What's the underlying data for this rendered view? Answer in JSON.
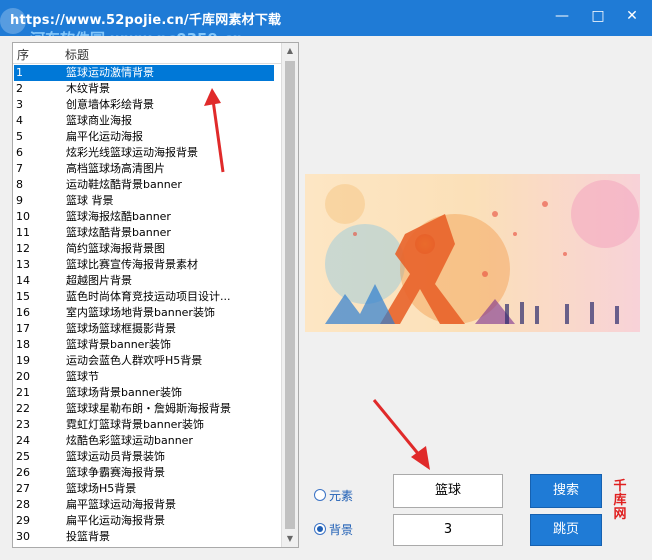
{
  "window": {
    "title": "https://www.52pojie.cn/千库网素材下载",
    "watermark": "河东软件园 www.pc0359.cn"
  },
  "list": {
    "col_index": "序",
    "col_title": "标题",
    "rows": [
      {
        "n": "1",
        "t": "篮球运动激情背景"
      },
      {
        "n": "2",
        "t": "木纹背景"
      },
      {
        "n": "3",
        "t": "创意墙体彩绘背景"
      },
      {
        "n": "4",
        "t": "篮球商业海报"
      },
      {
        "n": "5",
        "t": "扁平化运动海报"
      },
      {
        "n": "6",
        "t": "炫彩光线篮球运动海报背景"
      },
      {
        "n": "7",
        "t": "高档篮球场高清图片"
      },
      {
        "n": "8",
        "t": "运动鞋炫酷背景banner"
      },
      {
        "n": "9",
        "t": "篮球 背景"
      },
      {
        "n": "10",
        "t": "篮球海报炫酷banner"
      },
      {
        "n": "11",
        "t": "篮球炫酷背景banner"
      },
      {
        "n": "12",
        "t": "简约篮球海报背景图"
      },
      {
        "n": "13",
        "t": "篮球比赛宣传海报背景素材"
      },
      {
        "n": "14",
        "t": "超越图片背景"
      },
      {
        "n": "15",
        "t": "蓝色时尚体育竞技运动项目设计..."
      },
      {
        "n": "16",
        "t": "室内篮球场地背景banner装饰"
      },
      {
        "n": "17",
        "t": "篮球场篮球框摄影背景"
      },
      {
        "n": "18",
        "t": "篮球背景banner装饰"
      },
      {
        "n": "19",
        "t": "运动会蓝色人群欢呼H5背景"
      },
      {
        "n": "20",
        "t": "篮球节"
      },
      {
        "n": "21",
        "t": "篮球场背景banner装饰"
      },
      {
        "n": "22",
        "t": "篮球球星勒布朗・詹姆斯海报背景"
      },
      {
        "n": "23",
        "t": "霓虹灯篮球背景banner装饰"
      },
      {
        "n": "24",
        "t": "炫酷色彩篮球运动banner"
      },
      {
        "n": "25",
        "t": "篮球运动员背景装饰"
      },
      {
        "n": "26",
        "t": "篮球争霸赛海报背景"
      },
      {
        "n": "27",
        "t": "篮球场H5背景"
      },
      {
        "n": "28",
        "t": "扁平篮球运动海报背景"
      },
      {
        "n": "29",
        "t": "扁平化运动海报背景"
      },
      {
        "n": "30",
        "t": "投篮背景"
      }
    ],
    "selected_index": 0
  },
  "controls": {
    "radio_element": "元素",
    "radio_background": "背景",
    "radio_selected": "背景",
    "search_value": "篮球",
    "page_value": "3",
    "search_button": "搜索",
    "jump_button": "跳页",
    "brand_text": "千库网"
  },
  "colors": {
    "title_bar": "#1f7bd6",
    "button": "#1f7bd6",
    "selection": "#0078d7",
    "arrow": "#e02a2a"
  }
}
